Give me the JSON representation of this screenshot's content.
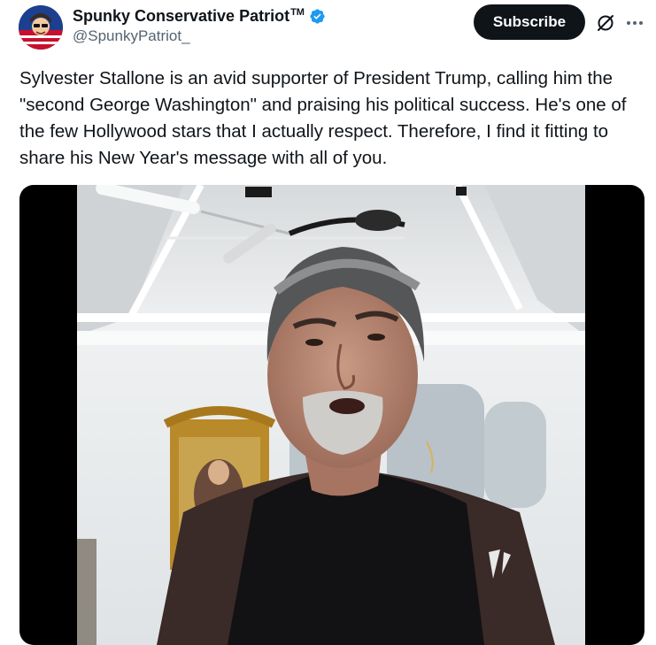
{
  "author": {
    "display_name": "Spunky Conservative Patriot",
    "trademark": "TM",
    "handle": "@SpunkyPatriot_",
    "verified_icon": "verified-badge-icon",
    "verified_color": "#1d9bf0"
  },
  "actions": {
    "subscribe_label": "Subscribe",
    "grok_icon": "grok-icon",
    "more_icon": "more-icon"
  },
  "tweet": {
    "text": "Sylvester Stallone is an avid supporter of President Trump, calling him the \"second George Washington\" and praising his political success. He's one of the few Hollywood stars that I actually respect. Therefore, I find it fitting to share his New Year's message with all of you."
  },
  "media": {
    "type": "video",
    "icon": "video-thumbnail"
  },
  "colors": {
    "text_primary": "#0f1419",
    "text_secondary": "#536471",
    "button_bg": "#0f1419",
    "button_text": "#ffffff"
  }
}
